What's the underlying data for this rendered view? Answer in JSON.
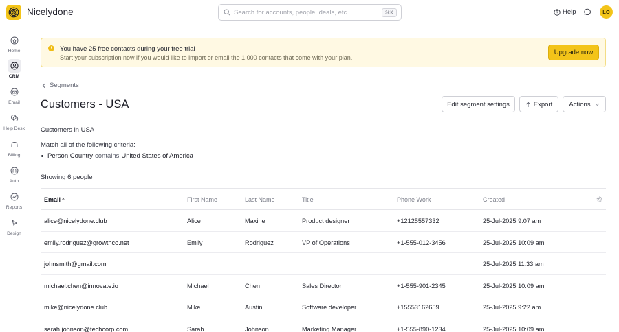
{
  "app": {
    "name": "Nicelydone"
  },
  "search": {
    "placeholder": "Search for accounts, people, deals, etc",
    "shortcut": "⌘K",
    "value": ""
  },
  "header": {
    "help_label": "Help",
    "avatar_initials": "LO"
  },
  "sidebar": {
    "items": [
      {
        "label": "Home",
        "icon": "home-icon",
        "active": false
      },
      {
        "label": "CRM",
        "icon": "crm-icon",
        "active": true
      },
      {
        "label": "Email",
        "icon": "email-icon",
        "active": false
      },
      {
        "label": "Help Desk",
        "icon": "help-desk-icon",
        "active": false
      },
      {
        "label": "Billing",
        "icon": "billing-icon",
        "active": false
      },
      {
        "label": "Auth",
        "icon": "auth-icon",
        "active": false
      },
      {
        "label": "Reports",
        "icon": "reports-icon",
        "active": false
      },
      {
        "label": "Design",
        "icon": "design-icon",
        "active": false
      }
    ]
  },
  "banner": {
    "title": "You have 25 free contacts during your free trial",
    "subtitle": "Start your subscription now if you would like to import or email the 1,000 contacts that come with your plan.",
    "cta_label": "Upgrade now"
  },
  "breadcrumb": {
    "back_label": "Segments"
  },
  "page": {
    "title": "Customers - USA",
    "description": "Customers in USA",
    "criteria_label": "Match all of the following criteria:",
    "criterion": {
      "property": "Person Country",
      "operator": "contains",
      "value": "United States of America"
    },
    "showing_label": "Showing 6 people"
  },
  "actions": {
    "edit_label": "Edit segment settings",
    "export_label": "Export",
    "actions_label": "Actions"
  },
  "table": {
    "columns": {
      "email": "Email",
      "first_name": "First Name",
      "last_name": "Last Name",
      "title": "Title",
      "phone": "Phone Work",
      "created": "Created"
    },
    "sort_indicator": "⌃",
    "rows": [
      {
        "email": "alice@nicelydone.club",
        "first_name": "Alice",
        "last_name": "Maxine",
        "title": "Product designer",
        "phone": "+12125557332",
        "created": "25-Jul-2025 9:07 am"
      },
      {
        "email": "emily.rodriguez@growthco.net",
        "first_name": "Emily",
        "last_name": "Rodriguez",
        "title": "VP of Operations",
        "phone": "+1-555-012-3456",
        "created": "25-Jul-2025 10:09 am"
      },
      {
        "email": "johnsmith@gmail.com",
        "first_name": "",
        "last_name": "",
        "title": "",
        "phone": "",
        "created": "25-Jul-2025 11:33 am"
      },
      {
        "email": "michael.chen@innovate.io",
        "first_name": "Michael",
        "last_name": "Chen",
        "title": "Sales Director",
        "phone": "+1-555-901-2345",
        "created": "25-Jul-2025 10:09 am"
      },
      {
        "email": "mike@nicelydone.club",
        "first_name": "Mike",
        "last_name": "Austin",
        "title": "Software developer",
        "phone": "+15553162659",
        "created": "25-Jul-2025 9:22 am"
      },
      {
        "email": "sarah.johnson@techcorp.com",
        "first_name": "Sarah",
        "last_name": "Johnson",
        "title": "Marketing Manager",
        "phone": "+1-555-890-1234",
        "created": "25-Jul-2025 10:09 am"
      }
    ]
  },
  "colors": {
    "accent": "#f3c419",
    "banner_bg": "#fff9e3",
    "banner_border": "#f3dd86"
  }
}
